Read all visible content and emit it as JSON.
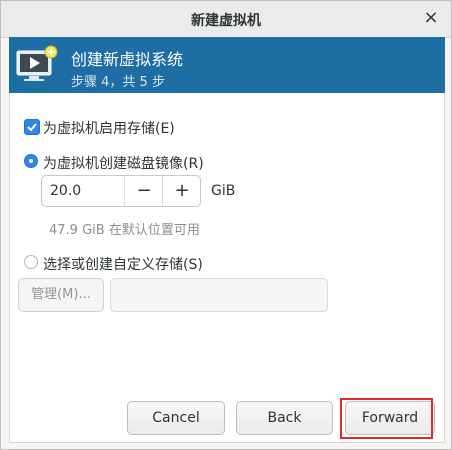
{
  "window": {
    "title": "新建虚拟机",
    "close_label": "×"
  },
  "banner": {
    "title": "创建新虚拟系统",
    "subtitle": "步骤 4，共 5 步",
    "icon": "monitor-play-icon"
  },
  "options": {
    "enable_storage_label": "为虚拟机启用存储(E)",
    "enable_storage_checked": true,
    "create_disk_label": "为虚拟机创建磁盘镜像(R)",
    "create_disk_selected": true,
    "disk_size_value": "20.0",
    "decrement_label": "−",
    "increment_label": "+",
    "unit_label": "GiB",
    "available_hint": "47.9 GiB 在默认位置可用",
    "custom_storage_label": "选择或创建自定义存储(S)",
    "custom_storage_selected": false,
    "manage_label": "管理(M)...",
    "custom_path_value": ""
  },
  "buttons": {
    "cancel": "Cancel",
    "back": "Back",
    "forward": "Forward"
  },
  "colors": {
    "banner": "#1c6ea4",
    "accent": "#3584e4",
    "highlight": "#e5262b"
  }
}
